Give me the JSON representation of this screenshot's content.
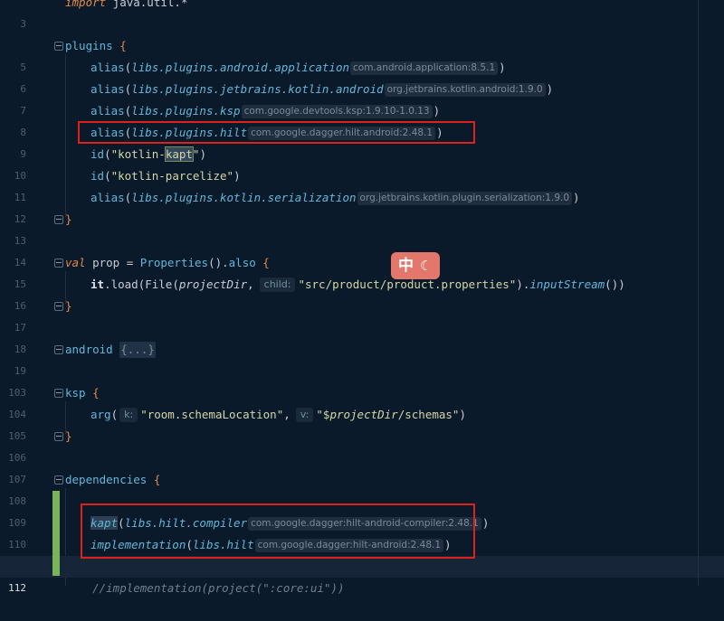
{
  "editor": {
    "lines": {
      "l3": {
        "num": "3",
        "kw": "import",
        "rest": " java.util.*"
      },
      "l5": {
        "num": "5",
        "id": "plugins",
        "brace": "{"
      },
      "l6": {
        "num": "6",
        "fn": "alias",
        "arg": "libs.plugins.android.application",
        "hint": "com.android.application:8.5.1"
      },
      "l7": {
        "num": "7",
        "fn": "alias",
        "arg": "libs.plugins.jetbrains.kotlin.android",
        "hint": "org.jetbrains.kotlin.android:1.9.0"
      },
      "l8": {
        "num": "8",
        "fn": "alias",
        "arg": "libs.plugins.ksp",
        "hint": "com.google.devtools.ksp:1.9.10-1.0.13"
      },
      "l9": {
        "num": "9",
        "fn": "alias",
        "arg": "libs.plugins.hilt",
        "hint": "com.google.dagger.hilt.android:2.48.1"
      },
      "l10": {
        "num": "10",
        "fn": "id",
        "str_a": "\"kotlin-",
        "str_hl": "kapt",
        "str_b": "\""
      },
      "l11": {
        "num": "11",
        "fn": "id",
        "str": "\"kotlin-parcelize\""
      },
      "l12": {
        "num": "12",
        "fn": "alias",
        "arg": "libs.plugins.kotlin.serialization",
        "hint": "org.jetbrains.kotlin.plugin.serialization:1.9.0"
      },
      "l13": {
        "num": "13",
        "brace": "}"
      },
      "l14": {
        "num": "14"
      },
      "l15": {
        "num": "15",
        "kw": "val",
        "var": " prop",
        "eq": " = ",
        "cls": "Properties",
        "call": "().",
        "fn": "also",
        "brace": " {"
      },
      "l16": {
        "num": "16",
        "it": "it",
        "dot": ".load(File(",
        "arg": "projectDir",
        "comma": ",",
        "phint": "child:",
        "str": "\"src/product/product.properties\"",
        "close": ").",
        "prop": "inputStream",
        "end": "())"
      },
      "l17": {
        "num": "17",
        "brace": "}"
      },
      "l18": {
        "num": "18"
      },
      "l19": {
        "num": "19",
        "id": "android",
        "collapsed": "{...}"
      },
      "l103": {
        "num": "103"
      },
      "l104": {
        "num": "104",
        "id": "ksp",
        "brace": "{"
      },
      "l105": {
        "num": "105",
        "fn": "arg",
        "open": "(",
        "phint1": "k:",
        "str1": "\"room.schemaLocation\"",
        "comma": ",",
        "phint2": "v:",
        "str2a": "\"$",
        "str2v": "projectDir",
        "str2b": "/schemas\"",
        "close": ")"
      },
      "l106": {
        "num": "106",
        "brace": "}"
      },
      "l107": {
        "num": "107"
      },
      "l108": {
        "num": "108",
        "id": "dependencies",
        "brace": "{"
      },
      "l109": {
        "num": "109"
      },
      "l110": {
        "num": "110",
        "fn": "kapt",
        "arg": "libs.hilt.compiler",
        "hint": "com.google.dagger:hilt-android-compiler:2.48.1"
      },
      "l111": {
        "num": "111",
        "fn": "implementation",
        "arg": "libs.hilt",
        "hint": "com.google.dagger:hilt-android:2.48.1"
      },
      "l112": {
        "num": "112"
      },
      "l113": {
        "text": "    //implementation(project(\":core:ui\"))"
      }
    }
  },
  "badge": {
    "zh": "中",
    "moon": "☾"
  },
  "colors": {
    "accent_red": "#e0201b",
    "change_green": "#79b35a",
    "badge": "#e4776b"
  }
}
